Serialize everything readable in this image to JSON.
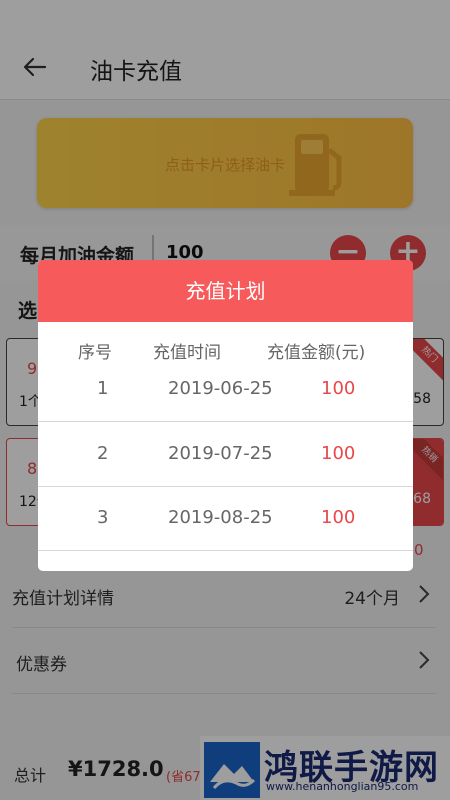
{
  "header": {
    "title": "油卡充值",
    "back_icon": "arrow-left-icon"
  },
  "card": {
    "hint": "点击卡片选择油卡",
    "icon": "fuel-pump-icon"
  },
  "amount": {
    "label": "每月加油金额",
    "value": "100",
    "minus": "−",
    "plus": "+"
  },
  "plans": {
    "label_partial": "选",
    "items": [
      {
        "left_top": "9",
        "left_bottom": "1个",
        "right_bottom": "58",
        "badge": "热门"
      },
      {
        "left_top": "8",
        "left_bottom": "12个",
        "right_bottom": "068",
        "badge": "热销"
      }
    ],
    "tail_value": "0"
  },
  "rows": [
    {
      "label": "充值计划详情",
      "value": "24个月"
    },
    {
      "label": "优惠券",
      "value": ""
    }
  ],
  "total": {
    "label": "总计",
    "value": "¥1728.0",
    "saving_partial": "(省67"
  },
  "watermark": {
    "text": "鸿联手游网",
    "url": "www.henanhonglian95.com"
  },
  "modal": {
    "title": "充值计划",
    "columns": [
      "序号",
      "充值时间",
      "充值金额(元)"
    ],
    "rows": [
      {
        "index": "1",
        "date": "2019-06-25",
        "amount": "100"
      },
      {
        "index": "2",
        "date": "2019-07-25",
        "amount": "100"
      },
      {
        "index": "3",
        "date": "2019-08-25",
        "amount": "100"
      }
    ]
  },
  "colors": {
    "accent": "#f65a5a",
    "amount_red": "#e8484a",
    "card_yellow": "#ffc845"
  }
}
